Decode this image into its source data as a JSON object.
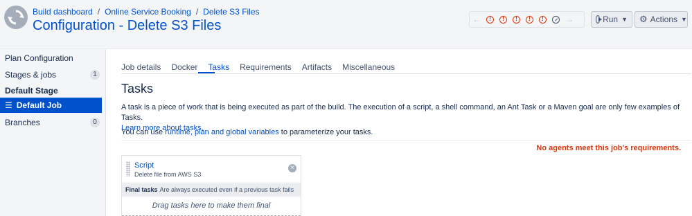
{
  "header": {
    "breadcrumb": [
      "Build dashboard",
      "Online Service Booking",
      "Delete S3 Files"
    ],
    "breadcrumb_separator": "/",
    "title": "Configuration - Delete S3 Files",
    "build_results": [
      "failed",
      "failed",
      "failed",
      "failed",
      "failed",
      "in-progress"
    ],
    "run_label": "Run",
    "actions_label": "Actions"
  },
  "sidebar": {
    "plan_configuration": "Plan Configuration",
    "stages_jobs": "Stages & jobs",
    "stages_jobs_count": "1",
    "stage_heading": "Default Stage",
    "active_job": "Default Job",
    "branches": "Branches",
    "branches_count": "0"
  },
  "tabs": [
    "Job details",
    "Docker",
    "Tasks",
    "Requirements",
    "Artifacts",
    "Miscellaneous"
  ],
  "active_tab": "Tasks",
  "main": {
    "title": "Tasks",
    "description": "A task is a piece of work that is being executed as part of the build. The execution of a script, a shell command, an Ant Task or a Maven goal are only few examples of Tasks.",
    "learn_more": "Learn more about tasks.",
    "vars_prefix": "You can use ",
    "vars_link": "runtime, plan and global variables",
    "vars_suffix": " to parameterize your tasks.",
    "warning": "No agents meet this job's requirements."
  },
  "tasks": {
    "items": [
      {
        "name": "Script",
        "description": "Delete file from AWS S3"
      }
    ],
    "final_label": "Final tasks",
    "final_note": "Are always executed even if a previous task fails",
    "dropzone": "Drag tasks here to make them final"
  },
  "colors": {
    "accent": "#0052cc",
    "error": "#de350b",
    "header_bg": "#f4f5f7"
  }
}
